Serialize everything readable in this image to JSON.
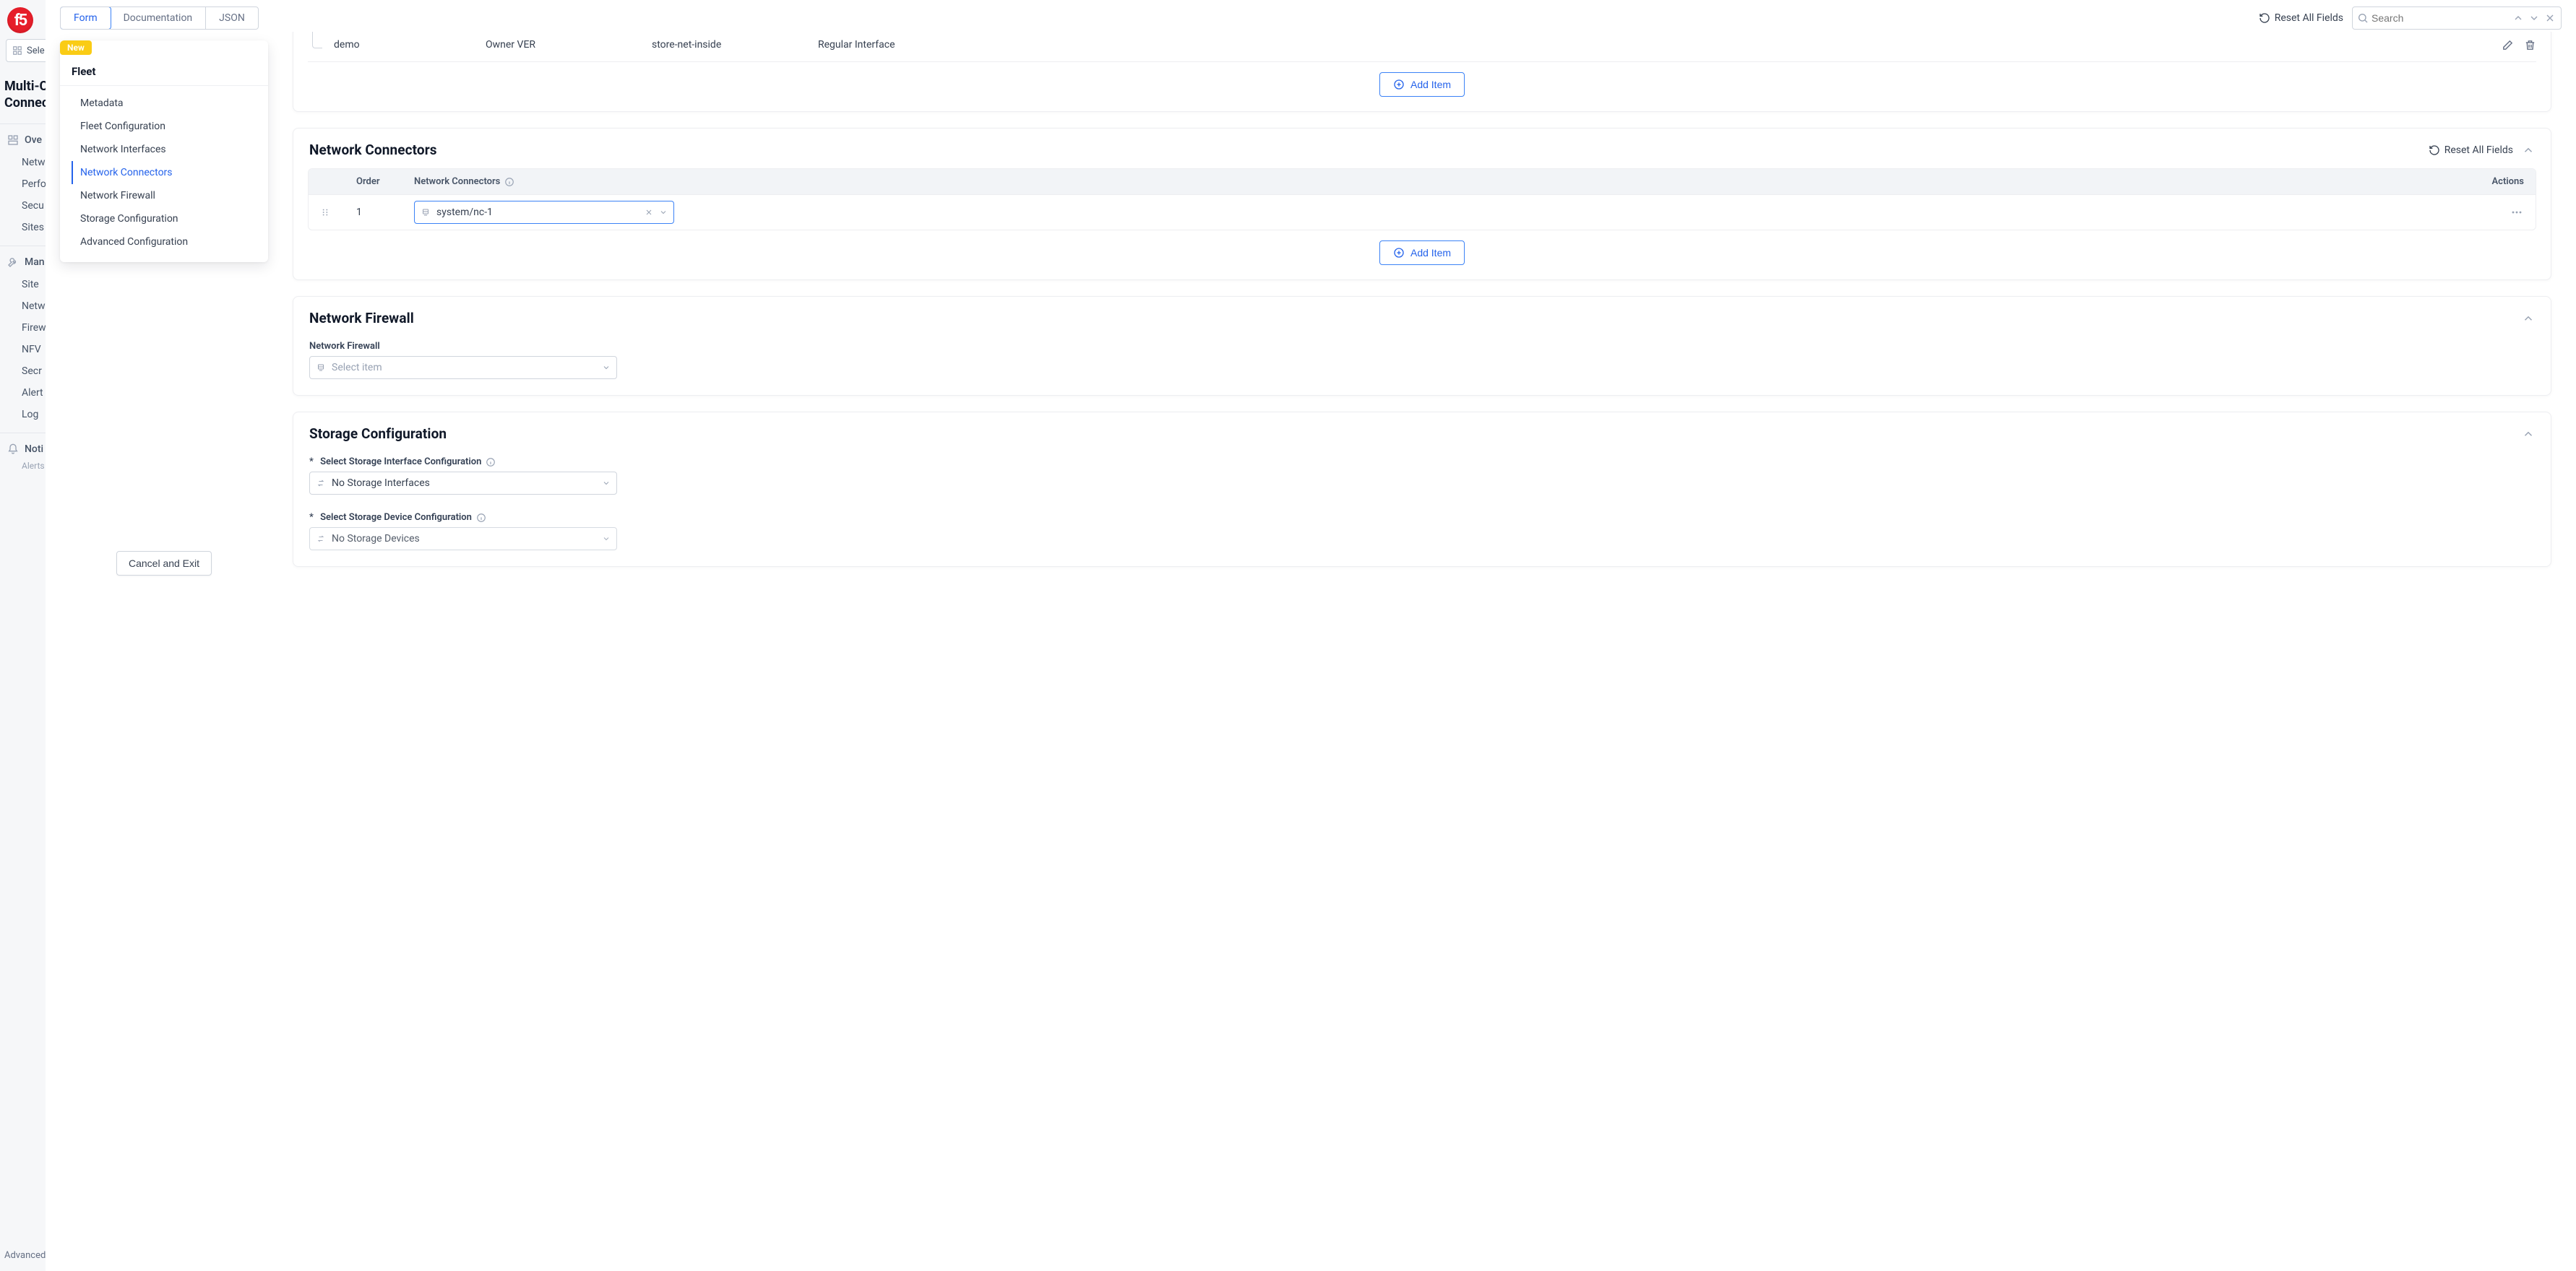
{
  "background_sidebar": {
    "select_label": "Sele",
    "heading_line1": "Multi-C",
    "heading_line2": "Connec",
    "group_overview": "Ove",
    "overview_items": [
      "Netw",
      "Perfo",
      "Secu",
      "Sites"
    ],
    "group_manage": "Man",
    "manage_items": [
      "Site",
      "Netw",
      "Firew",
      "NFV",
      "Secr",
      "Alert",
      "Log"
    ],
    "group_noti": "Noti",
    "noti_sub": "Alerts",
    "advanced": "Advanced"
  },
  "topbar": {
    "tabs": [
      "Form",
      "Documentation",
      "JSON"
    ],
    "reset_label": "Reset All Fields",
    "search_placeholder": "Search"
  },
  "left_nav": {
    "new_badge": "New",
    "title": "Fleet",
    "items": [
      "Metadata",
      "Fleet Configuration",
      "Network Interfaces",
      "Network Connectors",
      "Network Firewall",
      "Storage Configuration",
      "Advanced Configuration"
    ]
  },
  "cancel_label": "Cancel and Exit",
  "partial_row": {
    "c1": "demo",
    "c2": "Owner VER",
    "c3": "store-net-inside",
    "c4": "Regular Interface"
  },
  "add_item_label": "Add Item",
  "sections": {
    "network_connectors": {
      "title": "Network Connectors",
      "reset": "Reset All Fields",
      "headers": {
        "order": "Order",
        "nc": "Network Connectors",
        "actions": "Actions"
      },
      "row1": {
        "order": "1",
        "value": "system/nc-1"
      }
    },
    "network_firewall": {
      "title": "Network Firewall",
      "field_label": "Network Firewall",
      "placeholder": "Select item"
    },
    "storage": {
      "title": "Storage Configuration",
      "field1_label": "Select Storage Interface Configuration",
      "field1_value": "No Storage Interfaces",
      "field2_label": "Select Storage Device Configuration",
      "field2_value": "No Storage Devices"
    }
  }
}
